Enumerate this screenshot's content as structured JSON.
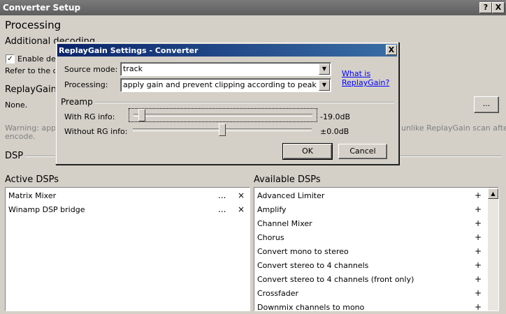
{
  "window": {
    "title": "Converter Setup",
    "help_label": "?",
    "close_label": "X"
  },
  "page": {
    "heading": "Processing",
    "additional_decoding": "Additional decoding",
    "enable_checkbox_label": "Enable dec",
    "refer_text": "Refer to the do",
    "replaygain_heading": "ReplayGain",
    "replaygain_value": "None.",
    "replaygain_button": "...",
    "warning_prefix": "Warning: apply",
    "warning_suffix": ", unlike ReplayGain scan after",
    "warning_line2": "encode.",
    "dsp_heading": "DSP",
    "active_dsps_heading": "Active DSPs",
    "available_dsps_heading": "Available DSPs"
  },
  "active_dsps": [
    {
      "label": "Matrix Mixer",
      "more": "...",
      "remove": "×"
    },
    {
      "label": "Winamp DSP bridge",
      "more": "...",
      "remove": "×"
    }
  ],
  "available_dsps": [
    {
      "label": "Advanced Limiter",
      "add": "+"
    },
    {
      "label": "Amplify",
      "add": "+"
    },
    {
      "label": "Channel Mixer",
      "add": "+"
    },
    {
      "label": "Chorus",
      "add": "+"
    },
    {
      "label": "Convert mono to stereo",
      "add": "+"
    },
    {
      "label": "Convert stereo to 4 channels",
      "add": "+"
    },
    {
      "label": "Convert stereo to 4 channels (front only)",
      "add": "+"
    },
    {
      "label": "Crossfader",
      "add": "+"
    },
    {
      "label": "Downmix channels to mono",
      "add": "+"
    }
  ],
  "dialog": {
    "title": "ReplayGain Settings - Converter",
    "close_label": "X",
    "source_mode_label": "Source mode:",
    "source_mode_value": "track",
    "processing_label": "Processing:",
    "processing_value": "apply gain and prevent clipping according to peak",
    "link_line1": "What is",
    "link_line2": "ReplayGain?",
    "preamp_heading": "Preamp",
    "with_rg_label": "With RG info:",
    "with_rg_value": "-19.0dB",
    "with_rg_level": 0.05,
    "without_rg_label": "Without RG info:",
    "without_rg_value": "±0.0dB",
    "without_rg_level": 0.5,
    "ok_label": "OK",
    "cancel_label": "Cancel"
  },
  "colors": {
    "accent": "#0a246a",
    "link": "#0000ff",
    "face": "#d4d0c8"
  }
}
